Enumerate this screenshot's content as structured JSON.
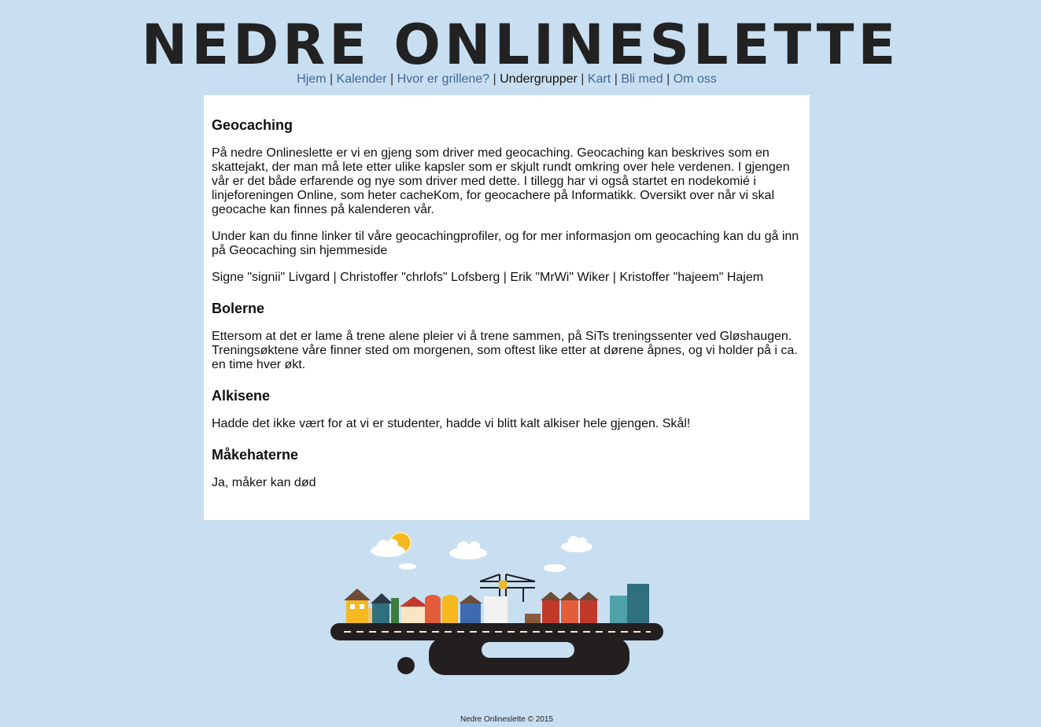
{
  "site": {
    "title": "NEDRE ONLINESLETTE"
  },
  "nav": {
    "items": [
      "Hjem",
      "Kalender",
      "Hvor er grillene?",
      "Undergrupper",
      "Kart",
      "Bli med",
      "Om oss"
    ],
    "active": "Undergrupper",
    "separator": "|"
  },
  "sections": {
    "geocaching": {
      "heading": "Geocaching",
      "p1": "På nedre Onlineslette er vi en gjeng som driver med geocaching. Geocaching kan beskrives som en skattejakt, der man må lete etter ulike kapsler som er skjult rundt omkring over hele verdenen. I gjengen vår er det både erfarende og nye som driver med dette. I tillegg har vi også startet en nodekomié i linjeforeningen Online, som heter cacheKom, for geocachere på Informatikk. Oversikt over når vi skal geocache kan finnes på kalenderen vår.",
      "p2": "Under kan du finne linker til våre geocachingprofiler, og for mer informasjon om geocaching kan du gå inn på Geocaching sin hjemmeside",
      "p3": "Signe \"signii\" Livgard | Christoffer \"chrlofs\" Lofsberg | Erik \"MrWi\" Wiker | Kristoffer \"hajeem\" Hajem"
    },
    "bolerne": {
      "heading": "Bolerne",
      "p1": "Ettersom at det er lame å trene alene pleier vi å trene sammen, på SiTs treningssenter ved Gløshaugen. Treningsøktene våre finner sted om morgenen, som oftest like etter at dørene åpnes, og vi holder på i ca. en time hver økt."
    },
    "alkisene": {
      "heading": "Alkisene",
      "p1": "Hadde det ikke vært for at vi er studenter, hadde vi blitt kalt alkiser hele gjengen. Skål!"
    },
    "makehaterne": {
      "heading": "Måkehaterne",
      "p1": "Ja, måker kan død"
    }
  },
  "footer": {
    "text": "Nedre Onlineslette © 2015"
  },
  "colors": {
    "background": "#c8dff2",
    "link": "#46678f",
    "road": "#231f20"
  }
}
